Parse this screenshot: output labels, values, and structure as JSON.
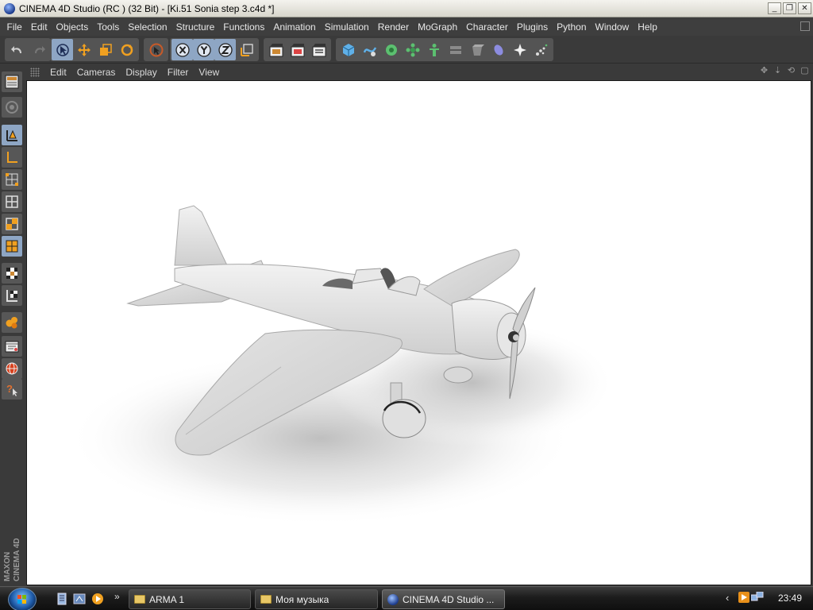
{
  "window": {
    "title": "CINEMA 4D Studio (RC ) (32 Bit) - [Ki.51 Sonia step 3.c4d *]",
    "controls": [
      "minimize",
      "restore",
      "close"
    ]
  },
  "menubar": {
    "items": [
      "File",
      "Edit",
      "Objects",
      "Tools",
      "Selection",
      "Structure",
      "Functions",
      "Animation",
      "Simulation",
      "Render",
      "MoGraph",
      "Character",
      "Plugins",
      "Python",
      "Window",
      "Help"
    ]
  },
  "toolbar": {
    "groups": [
      [
        "undo-icon",
        "redo-icon"
      ],
      [
        "select-arrow-icon",
        "move-icon",
        "scale-icon",
        "rotate-icon"
      ],
      [
        "live-selection-icon"
      ],
      [
        "x-axis-icon",
        "y-axis-icon",
        "z-axis-icon",
        "coordinate-system-icon"
      ],
      [
        "render-view-icon",
        "render-picture-viewer-icon",
        "render-settings-icon"
      ],
      [
        "cube-icon",
        "spline-pen-icon",
        "nurbs-icon",
        "array-icon",
        "character-icon",
        "deformer-icon",
        "scene-icon",
        "camera-icon",
        "light-icon",
        "particle-icon"
      ]
    ],
    "active_tool": "select-arrow-icon"
  },
  "left_tools": {
    "items": [
      "viewport-layout-icon",
      "texture-mode-icon",
      "model-mode-icon",
      "object-axis-icon",
      "points-mode-icon",
      "edges-mode-icon",
      "polygons-mode-icon",
      "uv-mode-icon",
      "checkerboard-icon",
      "workplane-icon",
      "sculpt-icon",
      "timeline-icon",
      "globe-icon",
      "help-icon"
    ],
    "active": [
      "model-mode-icon",
      "uv-mode-icon"
    ],
    "brand_line1": "MAXON",
    "brand_line2": "CINEMA 4D"
  },
  "viewport": {
    "menu": [
      "Edit",
      "Cameras",
      "Display",
      "Filter",
      "View"
    ],
    "controls": [
      "move-view-icon",
      "zoom-view-icon",
      "rotate-view-icon",
      "maximize-view-icon"
    ],
    "content": "white-rendered-aircraft-model"
  },
  "taskbar": {
    "quick_launch": [
      "show-desktop-icon",
      "media-library-icon",
      "media-player-icon"
    ],
    "more": "»",
    "tasks": [
      {
        "label": "ARMA 1",
        "icon": "folder-icon",
        "active": false
      },
      {
        "label": "Моя музыка",
        "icon": "folder-icon",
        "active": false
      },
      {
        "label": "CINEMA 4D Studio ...",
        "icon": "cinema4d-icon",
        "active": true
      }
    ],
    "tray_icons": [
      "tray-collapse-icon",
      "tray-player-icon",
      "tray-network-icon"
    ],
    "clock": "23:49"
  },
  "colors": {
    "accent": "#8ea6c4",
    "ui_bg": "#3a3a3a",
    "tool_group_bg": "#545454",
    "viewport_bg": "#ffffff"
  }
}
